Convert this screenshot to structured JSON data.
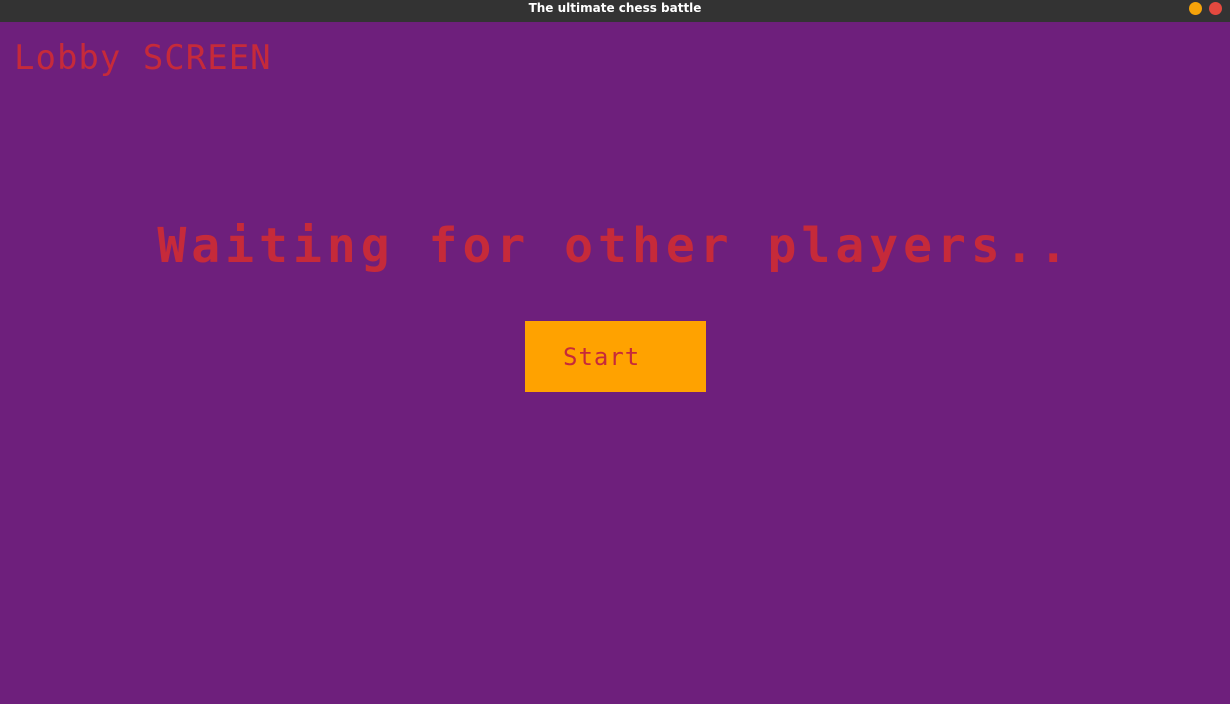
{
  "window": {
    "title": "The ultimate chess battle",
    "minimize_color": "#f5a30a",
    "close_color": "#e4493f"
  },
  "screen": {
    "heading": "Lobby SCREEN",
    "status_message": "Waiting for other players..",
    "start_button_label": "Start"
  },
  "colors": {
    "background": "#6e1f7c",
    "text": "#c62a3a",
    "button": "#ffa200",
    "titlebar": "#333333"
  }
}
